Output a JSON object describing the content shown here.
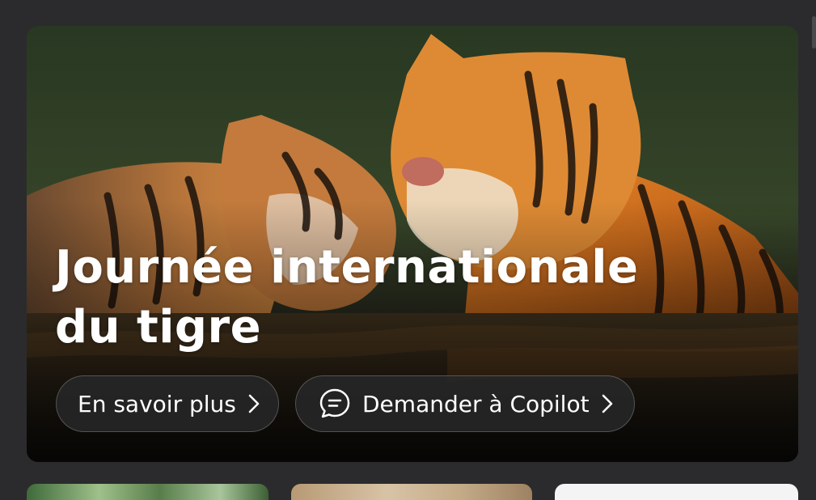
{
  "hero": {
    "title": "Journée internationale du tigre",
    "image_name": "two-tigers-in-water-photo",
    "learn_more_label": "En savoir plus",
    "ask_copilot_label": "Demander à Copilot"
  },
  "icons": {
    "chevron": "chevron-right-icon",
    "chat": "chat-bubble-icon"
  },
  "cards": [
    {
      "name": "card-jungle-leaves"
    },
    {
      "name": "card-desert-animal"
    },
    {
      "name": "card-white"
    }
  ]
}
